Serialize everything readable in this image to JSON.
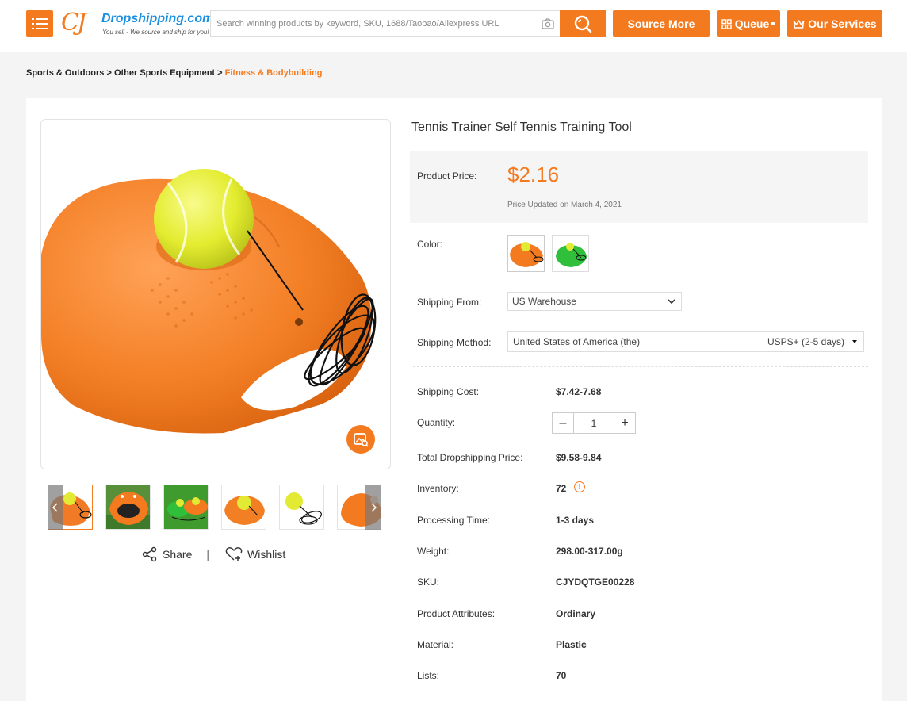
{
  "header": {
    "logo_mark": "CJ",
    "logo_name": "Dropshipping.com",
    "logo_tagline": "You sell - We source and ship for you!",
    "search_placeholder": "Search winning products by keyword, SKU, 1688/Taobao/Aliexpress URL",
    "buttons": {
      "source_more": "Source More",
      "queue": "Queue",
      "our_services": "Our Services"
    }
  },
  "breadcrumb": {
    "items": [
      "Sports & Outdoors",
      "Other Sports Equipment"
    ],
    "separator": ">",
    "current": "Fitness & Bodybuilding"
  },
  "gallery": {
    "thumbnails": [
      "thumb-1",
      "thumb-2",
      "thumb-3",
      "thumb-4",
      "thumb-5",
      "thumb-6"
    ],
    "share_label": "Share",
    "divider": "|",
    "wishlist_label": "Wishlist"
  },
  "product": {
    "title": "Tennis Trainer Self Tennis Training Tool",
    "price_label": "Product Price:",
    "price": "$2.16",
    "price_updated": "Price Updated on March 4, 2021",
    "color_label": "Color:",
    "colors": [
      "orange",
      "green"
    ],
    "shipping_from_label": "Shipping From:",
    "shipping_from": "US Warehouse",
    "shipping_method_label": "Shipping Method:",
    "shipping_country": "United States of America (the)",
    "shipping_method": "USPS+ (2-5 days)",
    "details": [
      {
        "label": "Shipping Cost:",
        "value": "$7.42-7.68"
      },
      {
        "label": "Quantity:",
        "value": "1"
      },
      {
        "label": "Total Dropshipping Price:",
        "value": "$9.58-9.84"
      },
      {
        "label": "Inventory:",
        "value": "72"
      },
      {
        "label": "Processing Time:",
        "value": "1-3 days"
      },
      {
        "label": "Weight:",
        "value": "298.00-317.00g"
      },
      {
        "label": "SKU:",
        "value": "CJYDQTGE00228"
      },
      {
        "label": "Product Attributes:",
        "value": "Ordinary"
      },
      {
        "label": "Material:",
        "value": "Plastic"
      },
      {
        "label": "Lists:",
        "value": "70"
      }
    ],
    "quantity_minus": "–",
    "quantity_plus": "+",
    "inventory_info_glyph": "!"
  },
  "colors": {
    "accent": "#f47a20",
    "link_blue": "#1a8fe0"
  }
}
